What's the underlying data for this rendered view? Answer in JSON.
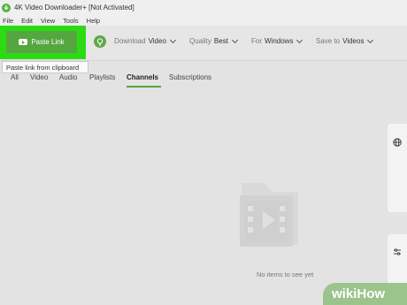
{
  "window": {
    "title": "4K Video Downloader+ [Not Activated]"
  },
  "menu": [
    "File",
    "Edit",
    "View",
    "Tools",
    "Help"
  ],
  "toolbar": {
    "paste_label": "Paste Link",
    "download_label": "Download",
    "download_value": "Video",
    "quality_label": "Quality",
    "quality_value": "Best",
    "platform_label": "For",
    "platform_value": "Windows",
    "save_label": "Save to",
    "save_value": "Videos",
    "accent_color": "#55a640",
    "highlight_color": "#2bdc15"
  },
  "tooltip": {
    "text": "Paste link from clipboard"
  },
  "tabs": {
    "all": "All",
    "video": "Video",
    "audio": "Audio",
    "playlists": "Playlists",
    "channels": "Channels",
    "subscriptions": "Subscriptions",
    "active": "Channels"
  },
  "empty_state": {
    "text": "No items to see yet"
  },
  "watermark": {
    "wiki": "wiki",
    "how": "How"
  },
  "icons": [
    "app-logo-icon",
    "youtube-icon",
    "lightbulb-icon",
    "globe-icon",
    "settings-sliders-icon",
    "video-folder-icon"
  ]
}
